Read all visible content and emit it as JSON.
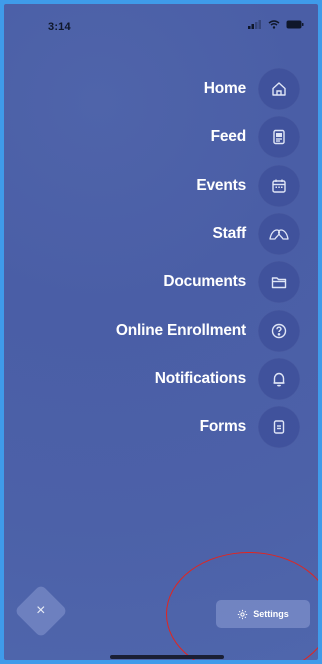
{
  "status_bar": {
    "time": "3:14",
    "icons": [
      "cellular-signal-icon",
      "wifi-icon",
      "battery-icon"
    ]
  },
  "menu": {
    "items": [
      {
        "label": "Home",
        "icon": "home-icon"
      },
      {
        "label": "Feed",
        "icon": "feed-icon"
      },
      {
        "label": "Events",
        "icon": "calendar-icon"
      },
      {
        "label": "Staff",
        "icon": "staff-icon"
      },
      {
        "label": "Documents",
        "icon": "folder-icon"
      },
      {
        "label": "Online Enrollment",
        "icon": "help-circle-icon"
      },
      {
        "label": "Notifications",
        "icon": "bell-icon"
      },
      {
        "label": "Forms",
        "icon": "form-icon"
      }
    ]
  },
  "close_button": {
    "glyph": "×",
    "icon": "close-icon"
  },
  "settings_button": {
    "label": "Settings",
    "icon": "gear-icon"
  },
  "colors": {
    "overlay": "#4c61a8",
    "frame": "#3f9bea",
    "icon_circle": "#3f519b",
    "annotation": "#e2251f"
  }
}
